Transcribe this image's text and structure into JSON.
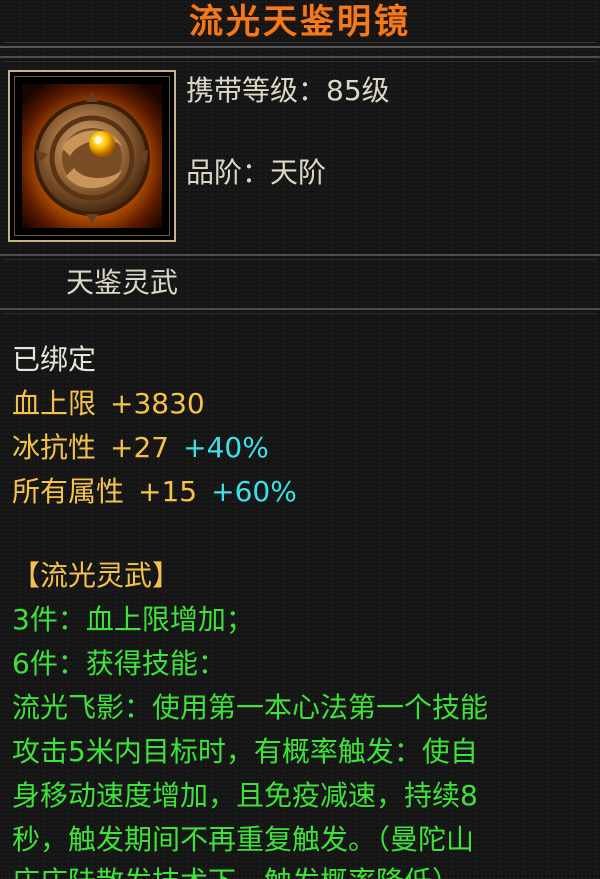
{
  "title": "流光天鉴明镜",
  "item": {
    "icon": "bronze-mirror-icon",
    "carry_level": "携带等级：85级",
    "grade": "品阶：天阶"
  },
  "subtitle": "天鉴灵武",
  "status": "已绑定",
  "attributes": [
    {
      "name": "血上限",
      "value": "+3830",
      "bonus": ""
    },
    {
      "name": "冰抗性",
      "value": "+27",
      "bonus": "+40%"
    },
    {
      "name": "所有属性",
      "value": "+15",
      "bonus": "+60%"
    }
  ],
  "set": {
    "name": "【流光灵武】",
    "lines": [
      "3件：血上限增加；",
      "6件：获得技能：",
      "流光飞影：使用第一本心法第一个技能",
      "攻击5米内目标时，有概率触发：使自",
      "身移动速度增加，且免疫减速，持续8",
      "秒，触发期间不再重复触发。（曼陀山",
      "庄庄陆散发技术下，触发概率降低）"
    ]
  },
  "colors": {
    "title": "#f07a1e",
    "normal": "#e6e4d6",
    "attr": "#f4c24a",
    "bonus": "#3de0e6",
    "set": "#3ee23a"
  }
}
